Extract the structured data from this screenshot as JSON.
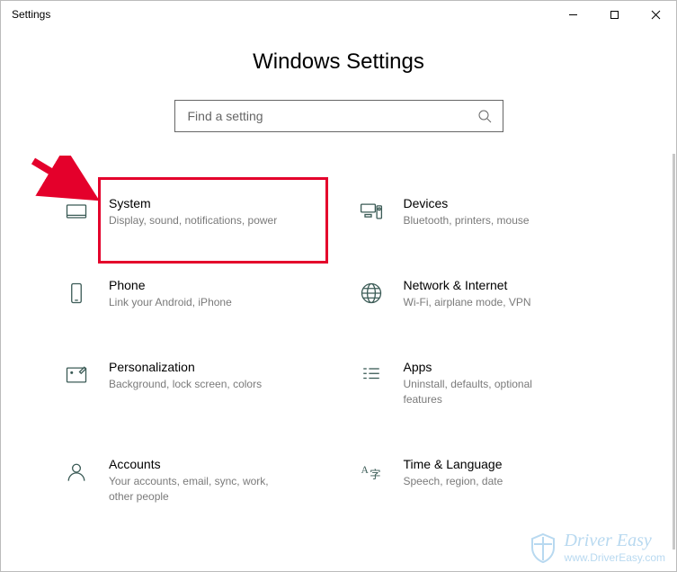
{
  "window": {
    "title": "Settings"
  },
  "header": {
    "page_title": "Windows Settings"
  },
  "search": {
    "placeholder": "Find a setting"
  },
  "tiles": {
    "system": {
      "title": "System",
      "sub": "Display, sound, notifications, power"
    },
    "devices": {
      "title": "Devices",
      "sub": "Bluetooth, printers, mouse"
    },
    "phone": {
      "title": "Phone",
      "sub": "Link your Android, iPhone"
    },
    "network": {
      "title": "Network & Internet",
      "sub": "Wi-Fi, airplane mode, VPN"
    },
    "personalization": {
      "title": "Personalization",
      "sub": "Background, lock screen, colors"
    },
    "apps": {
      "title": "Apps",
      "sub": "Uninstall, defaults, optional features"
    },
    "accounts": {
      "title": "Accounts",
      "sub": "Your accounts, email, sync, work, other people"
    },
    "time": {
      "title": "Time & Language",
      "sub": "Speech, region, date"
    }
  },
  "watermark": {
    "brand": "Driver Easy",
    "url": "www.DriverEasy.com"
  },
  "annotation": {
    "highlight_target": "system"
  }
}
